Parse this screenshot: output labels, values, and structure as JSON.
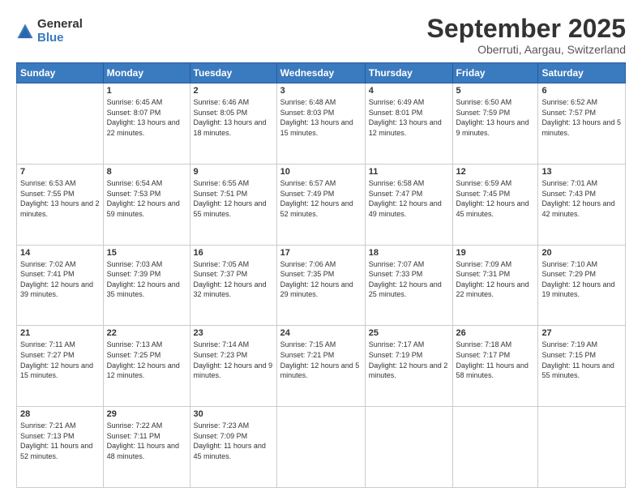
{
  "header": {
    "logo": {
      "general": "General",
      "blue": "Blue"
    },
    "title": "September 2025",
    "location": "Oberruti, Aargau, Switzerland"
  },
  "calendar": {
    "days": [
      "Sunday",
      "Monday",
      "Tuesday",
      "Wednesday",
      "Thursday",
      "Friday",
      "Saturday"
    ],
    "weeks": [
      [
        {
          "day": "",
          "info": ""
        },
        {
          "day": "1",
          "info": "Sunrise: 6:45 AM\nSunset: 8:07 PM\nDaylight: 13 hours\nand 22 minutes."
        },
        {
          "day": "2",
          "info": "Sunrise: 6:46 AM\nSunset: 8:05 PM\nDaylight: 13 hours\nand 18 minutes."
        },
        {
          "day": "3",
          "info": "Sunrise: 6:48 AM\nSunset: 8:03 PM\nDaylight: 13 hours\nand 15 minutes."
        },
        {
          "day": "4",
          "info": "Sunrise: 6:49 AM\nSunset: 8:01 PM\nDaylight: 13 hours\nand 12 minutes."
        },
        {
          "day": "5",
          "info": "Sunrise: 6:50 AM\nSunset: 7:59 PM\nDaylight: 13 hours\nand 9 minutes."
        },
        {
          "day": "6",
          "info": "Sunrise: 6:52 AM\nSunset: 7:57 PM\nDaylight: 13 hours\nand 5 minutes."
        }
      ],
      [
        {
          "day": "7",
          "info": "Sunrise: 6:53 AM\nSunset: 7:55 PM\nDaylight: 13 hours\nand 2 minutes."
        },
        {
          "day": "8",
          "info": "Sunrise: 6:54 AM\nSunset: 7:53 PM\nDaylight: 12 hours\nand 59 minutes."
        },
        {
          "day": "9",
          "info": "Sunrise: 6:55 AM\nSunset: 7:51 PM\nDaylight: 12 hours\nand 55 minutes."
        },
        {
          "day": "10",
          "info": "Sunrise: 6:57 AM\nSunset: 7:49 PM\nDaylight: 12 hours\nand 52 minutes."
        },
        {
          "day": "11",
          "info": "Sunrise: 6:58 AM\nSunset: 7:47 PM\nDaylight: 12 hours\nand 49 minutes."
        },
        {
          "day": "12",
          "info": "Sunrise: 6:59 AM\nSunset: 7:45 PM\nDaylight: 12 hours\nand 45 minutes."
        },
        {
          "day": "13",
          "info": "Sunrise: 7:01 AM\nSunset: 7:43 PM\nDaylight: 12 hours\nand 42 minutes."
        }
      ],
      [
        {
          "day": "14",
          "info": "Sunrise: 7:02 AM\nSunset: 7:41 PM\nDaylight: 12 hours\nand 39 minutes."
        },
        {
          "day": "15",
          "info": "Sunrise: 7:03 AM\nSunset: 7:39 PM\nDaylight: 12 hours\nand 35 minutes."
        },
        {
          "day": "16",
          "info": "Sunrise: 7:05 AM\nSunset: 7:37 PM\nDaylight: 12 hours\nand 32 minutes."
        },
        {
          "day": "17",
          "info": "Sunrise: 7:06 AM\nSunset: 7:35 PM\nDaylight: 12 hours\nand 29 minutes."
        },
        {
          "day": "18",
          "info": "Sunrise: 7:07 AM\nSunset: 7:33 PM\nDaylight: 12 hours\nand 25 minutes."
        },
        {
          "day": "19",
          "info": "Sunrise: 7:09 AM\nSunset: 7:31 PM\nDaylight: 12 hours\nand 22 minutes."
        },
        {
          "day": "20",
          "info": "Sunrise: 7:10 AM\nSunset: 7:29 PM\nDaylight: 12 hours\nand 19 minutes."
        }
      ],
      [
        {
          "day": "21",
          "info": "Sunrise: 7:11 AM\nSunset: 7:27 PM\nDaylight: 12 hours\nand 15 minutes."
        },
        {
          "day": "22",
          "info": "Sunrise: 7:13 AM\nSunset: 7:25 PM\nDaylight: 12 hours\nand 12 minutes."
        },
        {
          "day": "23",
          "info": "Sunrise: 7:14 AM\nSunset: 7:23 PM\nDaylight: 12 hours\nand 9 minutes."
        },
        {
          "day": "24",
          "info": "Sunrise: 7:15 AM\nSunset: 7:21 PM\nDaylight: 12 hours\nand 5 minutes."
        },
        {
          "day": "25",
          "info": "Sunrise: 7:17 AM\nSunset: 7:19 PM\nDaylight: 12 hours\nand 2 minutes."
        },
        {
          "day": "26",
          "info": "Sunrise: 7:18 AM\nSunset: 7:17 PM\nDaylight: 11 hours\nand 58 minutes."
        },
        {
          "day": "27",
          "info": "Sunrise: 7:19 AM\nSunset: 7:15 PM\nDaylight: 11 hours\nand 55 minutes."
        }
      ],
      [
        {
          "day": "28",
          "info": "Sunrise: 7:21 AM\nSunset: 7:13 PM\nDaylight: 11 hours\nand 52 minutes."
        },
        {
          "day": "29",
          "info": "Sunrise: 7:22 AM\nSunset: 7:11 PM\nDaylight: 11 hours\nand 48 minutes."
        },
        {
          "day": "30",
          "info": "Sunrise: 7:23 AM\nSunset: 7:09 PM\nDaylight: 11 hours\nand 45 minutes."
        },
        {
          "day": "",
          "info": ""
        },
        {
          "day": "",
          "info": ""
        },
        {
          "day": "",
          "info": ""
        },
        {
          "day": "",
          "info": ""
        }
      ]
    ]
  }
}
